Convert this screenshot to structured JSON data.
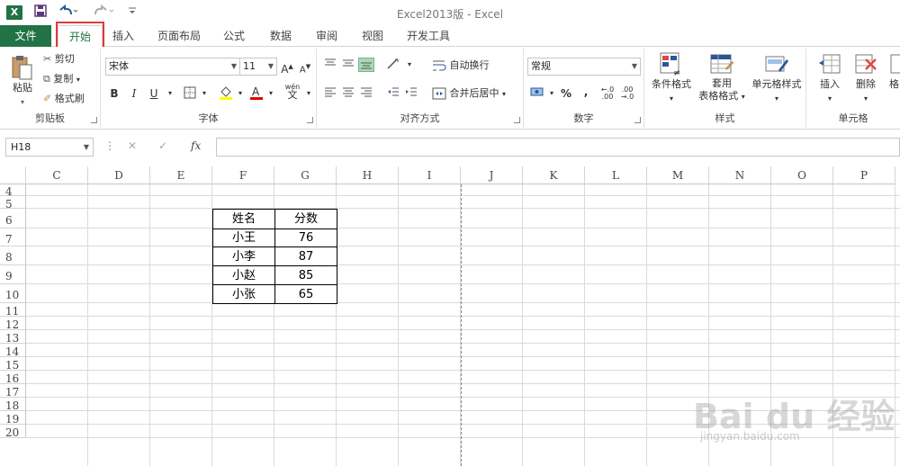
{
  "title_bar": {
    "title": "Excel2013版 - Excel",
    "app_icon": "X"
  },
  "quick_access": {
    "save_icon": "save-icon",
    "undo_icon": "undo-icon",
    "redo_icon": "redo-icon"
  },
  "tabs": [
    {
      "label": "文件"
    },
    {
      "label": "开始"
    },
    {
      "label": "插入"
    },
    {
      "label": "页面布局"
    },
    {
      "label": "公式"
    },
    {
      "label": "数据"
    },
    {
      "label": "审阅"
    },
    {
      "label": "视图"
    },
    {
      "label": "开发工具"
    }
  ],
  "ribbon": {
    "clipboard": {
      "label": "剪贴板",
      "paste": "粘贴",
      "cut": "剪切",
      "copy": "复制",
      "format_painter": "格式刷"
    },
    "font": {
      "label": "字体",
      "font_name": "宋体",
      "font_size": "11",
      "bold": "B",
      "italic": "I",
      "underline": "U",
      "phonetic": "wén",
      "phonetic_char": "文"
    },
    "alignment": {
      "label": "对齐方式",
      "wrap_text": "自动换行",
      "merge_center": "合并后居中"
    },
    "number": {
      "label": "数字",
      "format": "常规",
      "percent": "%",
      "comma": ","
    },
    "styles": {
      "label": "样式",
      "conditional": "条件格式",
      "table_format_1": "套用",
      "table_format_2": "表格格式",
      "cell_styles": "单元格样式"
    },
    "cells": {
      "label": "单元格",
      "insert": "插入",
      "delete": "删除",
      "format": "格"
    }
  },
  "formula_bar": {
    "name_box": "H18",
    "fx": "fx",
    "value": ""
  },
  "columns": [
    "C",
    "D",
    "E",
    "F",
    "G",
    "H",
    "I",
    "J",
    "K",
    "L",
    "M",
    "N",
    "O",
    "P"
  ],
  "rows": [
    "4",
    "5",
    "6",
    "7",
    "8",
    "9",
    "10",
    "11",
    "12",
    "13",
    "14",
    "15",
    "16",
    "17",
    "18",
    "19",
    "20"
  ],
  "table": {
    "headers": [
      "姓名",
      "分数"
    ],
    "rows": [
      [
        "小王",
        "76"
      ],
      [
        "小李",
        "87"
      ],
      [
        "小赵",
        "85"
      ],
      [
        "小张",
        "65"
      ]
    ]
  },
  "watermark": {
    "text": "Bai du 经验",
    "url": "jingyan.baidu.com"
  }
}
